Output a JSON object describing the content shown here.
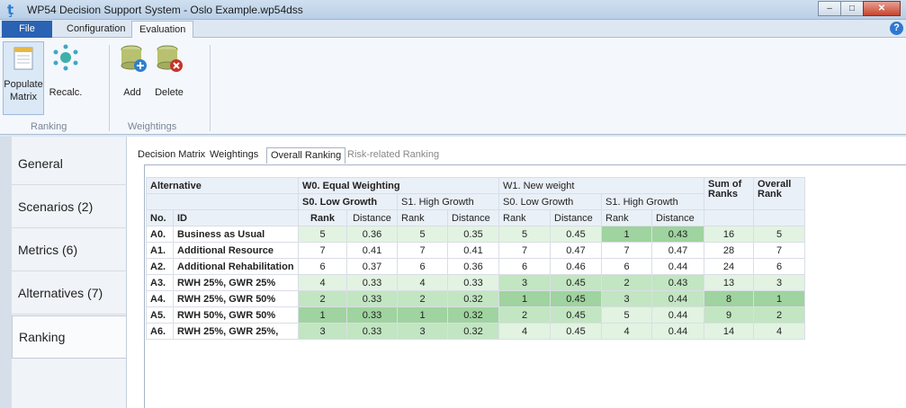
{
  "window": {
    "title": "WP54 Decision Support System - Oslo Example.wp54dss",
    "min": "–",
    "max": "□",
    "close": "✕"
  },
  "ribbon": {
    "tabs": {
      "file": "File",
      "configuration": "Configuration",
      "evaluation": "Evaluation"
    },
    "help": "?",
    "buttons": {
      "populate": [
        "Populate",
        "Matrix"
      ],
      "recalc": "Recalc.",
      "add": "Add",
      "delete": "Delete"
    },
    "groups": {
      "ranking": "Ranking",
      "weightings": "Weightings"
    }
  },
  "nav": {
    "items": [
      "General",
      "Scenarios (2)",
      "Metrics (6)",
      "Alternatives (7)",
      "Ranking"
    ]
  },
  "subtabs": [
    "Decision Matrix",
    "Weightings",
    "Overall Ranking",
    "Risk-related Ranking"
  ],
  "table": {
    "header": {
      "alternative": "Alternative",
      "w0": "W0. Equal Weighting",
      "w1": "W1. New weight",
      "sum_ranks": [
        "Sum of",
        "Ranks"
      ],
      "overall_rank": [
        "Overall",
        "Rank"
      ],
      "s0": "S0. Low Growth",
      "s1": "S1. High Growth",
      "no": "No.",
      "id": "ID",
      "rank": "Rank",
      "distance": "Distance"
    },
    "rows": [
      {
        "no": "A0.",
        "id": "Business as Usual",
        "cells": [
          "5",
          "0.36",
          "5",
          "0.35",
          "5",
          "0.45",
          "1",
          "0.43"
        ],
        "sum": "16",
        "overall": "5"
      },
      {
        "no": "A1.",
        "id": "Additional Resource",
        "cells": [
          "7",
          "0.41",
          "7",
          "0.41",
          "7",
          "0.47",
          "7",
          "0.47"
        ],
        "sum": "28",
        "overall": "7"
      },
      {
        "no": "A2.",
        "id": "Additional Rehabilitation",
        "cells": [
          "6",
          "0.37",
          "6",
          "0.36",
          "6",
          "0.46",
          "6",
          "0.44"
        ],
        "sum": "24",
        "overall": "6"
      },
      {
        "no": "A3.",
        "id": "RWH 25%, GWR 25%",
        "cells": [
          "4",
          "0.33",
          "4",
          "0.33",
          "3",
          "0.45",
          "2",
          "0.43"
        ],
        "sum": "13",
        "overall": "3"
      },
      {
        "no": "A4.",
        "id": "RWH 25%, GWR 50%",
        "cells": [
          "2",
          "0.33",
          "2",
          "0.32",
          "1",
          "0.45",
          "3",
          "0.44"
        ],
        "sum": "8",
        "overall": "1"
      },
      {
        "no": "A5.",
        "id": "RWH 50%, GWR 50%",
        "cells": [
          "1",
          "0.33",
          "1",
          "0.32",
          "2",
          "0.45",
          "5",
          "0.44"
        ],
        "sum": "9",
        "overall": "2"
      },
      {
        "no": "A6.",
        "id": "RWH 25%, GWR 25%,",
        "cells": [
          "3",
          "0.33",
          "3",
          "0.32",
          "4",
          "0.45",
          "4",
          "0.44"
        ],
        "sum": "14",
        "overall": "4"
      }
    ]
  }
}
